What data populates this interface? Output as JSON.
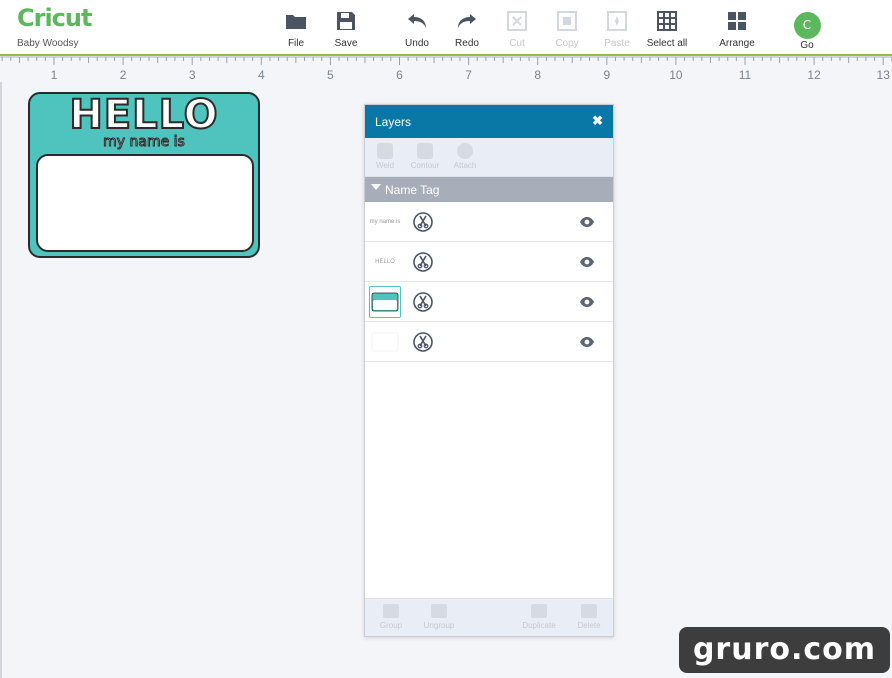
{
  "app": {
    "logo_text": "Cricut",
    "project_name": "Baby Woodsy"
  },
  "toolbar": {
    "file": "File",
    "save": "Save",
    "undo": "Undo",
    "redo": "Redo",
    "cut": "Cut",
    "copy": "Copy",
    "paste": "Paste",
    "select_all": "Select all",
    "arrange": "Arrange",
    "go_badge": "C",
    "go": "Go"
  },
  "ruler": {
    "labels": [
      "1",
      "2",
      "3",
      "4",
      "5",
      "6",
      "7",
      "8",
      "9",
      "10",
      "11",
      "12",
      "13"
    ]
  },
  "design": {
    "headline": "HELLO",
    "subline": "my name is",
    "fill_color": "#4fc3bd"
  },
  "layers_panel": {
    "title": "Layers",
    "close_icon": "close-icon",
    "actions": {
      "weld": "Weld",
      "contour": "Contour",
      "attach": "Attach"
    },
    "group_name": "Name Tag",
    "rows": [
      {
        "thumb_text": "my name is",
        "operation_icon": "scissors-icon",
        "visibility_icon": "eye-icon"
      },
      {
        "thumb_text": "HELLO",
        "operation_icon": "scissors-icon",
        "visibility_icon": "eye-icon"
      },
      {
        "thumb_text": "",
        "operation_icon": "scissors-icon",
        "visibility_icon": "eye-icon"
      },
      {
        "thumb_text": "",
        "operation_icon": "scissors-icon",
        "visibility_icon": "eye-icon"
      }
    ],
    "footer": {
      "group": "Group",
      "ungroup": "Ungroup",
      "duplicate": "Duplicate",
      "delete": "Delete"
    }
  },
  "colors": {
    "header_blue": "#0a78a6",
    "brand_green": "#5cb85c",
    "teal": "#4fc3bd"
  },
  "watermark": "gruro.com"
}
